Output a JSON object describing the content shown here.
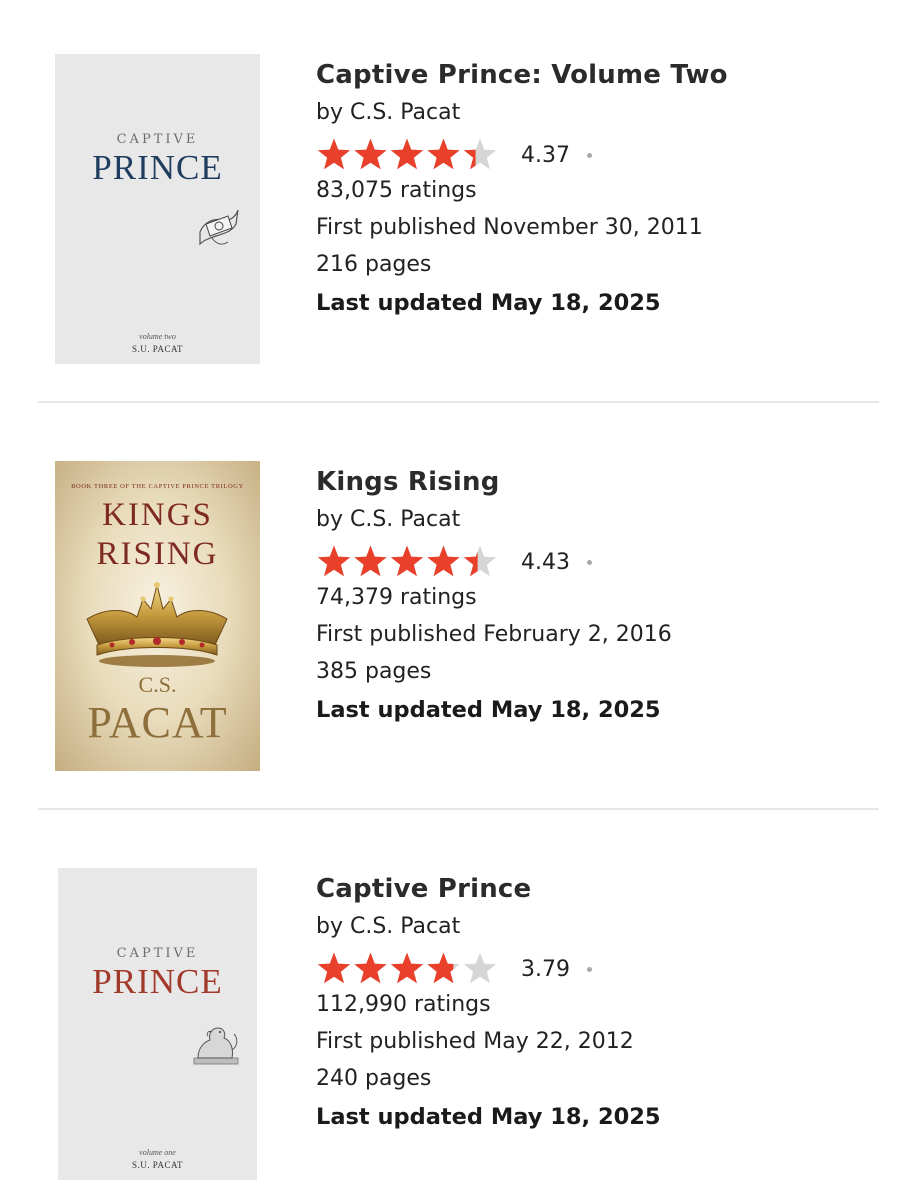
{
  "books": [
    {
      "title": "Captive Prince: Volume Two",
      "author_line": "by C.S. Pacat",
      "rating": 4.37,
      "rating_text": "4.37",
      "ratings_count": "83,075 ratings",
      "published": "First published November 30, 2011",
      "pages": "216 pages",
      "updated": "Last updated May 18, 2025",
      "cover": {
        "series": "CAPTIVE",
        "title": "PRINCE",
        "volume": "volume two",
        "author": "S.U. PACAT"
      }
    },
    {
      "title": "Kings Rising",
      "author_line": "by C.S. Pacat",
      "rating": 4.43,
      "rating_text": "4.43",
      "ratings_count": "74,379 ratings",
      "published": "First published February 2, 2016",
      "pages": "385 pages",
      "updated": "Last updated May 18, 2025",
      "cover": {
        "tagline": "Book three of the Captive Prince Trilogy",
        "line1": "KINGS",
        "line2": "RISING",
        "initials": "C.S.",
        "surname": "PACAT"
      }
    },
    {
      "title": "Captive Prince",
      "author_line": "by C.S. Pacat",
      "rating": 3.79,
      "rating_text": "3.79",
      "ratings_count": "112,990 ratings",
      "published": "First published May 22, 2012",
      "pages": "240 pages",
      "updated": "Last updated May 18, 2025",
      "cover": {
        "series": "CAPTIVE",
        "title": "PRINCE",
        "volume": "volume one",
        "author": "S.U. PACAT"
      }
    }
  ],
  "colors": {
    "star_filled": "#e8402a",
    "star_empty": "#d6d6d6"
  }
}
